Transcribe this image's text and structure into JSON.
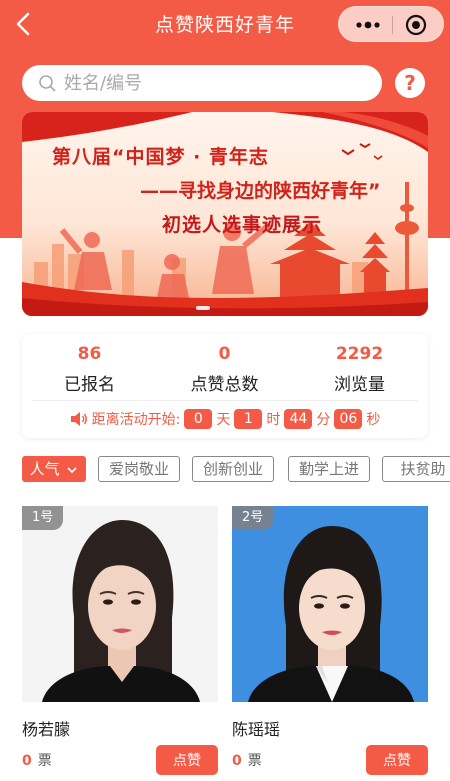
{
  "nav": {
    "title": "点赞陕西好青年"
  },
  "search": {
    "placeholder": "姓名/编号",
    "help": "?"
  },
  "banner": {
    "line1": "第八届“中国梦 · 青年志",
    "line2": "——寻找身边的陕西好青年”",
    "line3": "初选人选事迹展示"
  },
  "stats": [
    {
      "value": "86",
      "label": "已报名"
    },
    {
      "value": "0",
      "label": "点赞总数"
    },
    {
      "value": "2292",
      "label": "浏览量"
    }
  ],
  "countdown": {
    "prefix": "距离活动开始:",
    "days": "0",
    "days_unit": "天",
    "hours": "1",
    "hours_unit": "时",
    "minutes": "44",
    "minutes_unit": "分",
    "seconds": "06",
    "seconds_unit": "秒"
  },
  "filters": [
    {
      "label": "人气",
      "active": true
    },
    {
      "label": "爱岗敬业",
      "active": false
    },
    {
      "label": "创新创业",
      "active": false
    },
    {
      "label": "勤学上进",
      "active": false
    },
    {
      "label": "扶贫助",
      "active": false
    }
  ],
  "candidates": [
    {
      "tag": "1号",
      "name": "杨若朦",
      "votes": "0",
      "votes_unit": "票",
      "button": "点赞",
      "photo_bg": "#f4f4f4"
    },
    {
      "tag": "2号",
      "name": "陈瑶瑶",
      "votes": "0",
      "votes_unit": "票",
      "button": "点赞",
      "photo_bg": "#3f8fe0"
    }
  ],
  "colors": {
    "accent": "#f45b46",
    "banner_text": "#d2231b"
  }
}
